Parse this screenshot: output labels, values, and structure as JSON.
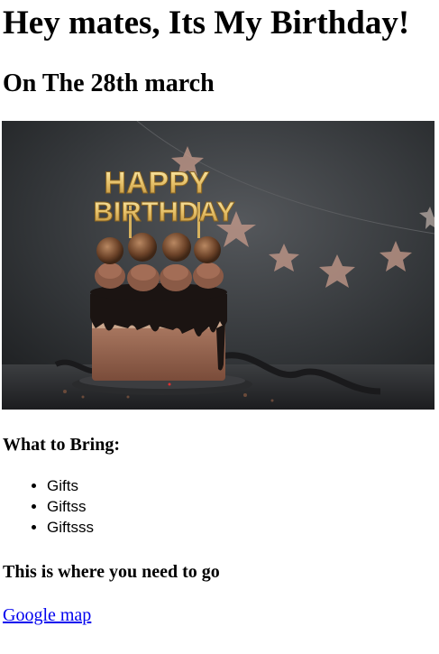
{
  "heading": "Hey mates, Its My Birthday!",
  "date_heading": "On The 28th march",
  "image": {
    "topper_line1": "HAPPY",
    "topper_line2": "BIRTHDAY"
  },
  "bring": {
    "heading": "What to Bring:",
    "items": [
      "Gifts",
      "Giftss",
      "Giftsss"
    ]
  },
  "location": {
    "heading": "This is where you need to go",
    "link_label": "Google map"
  },
  "colors": {
    "link": "#0000ee",
    "background": "#ffffff",
    "text": "#000000"
  }
}
